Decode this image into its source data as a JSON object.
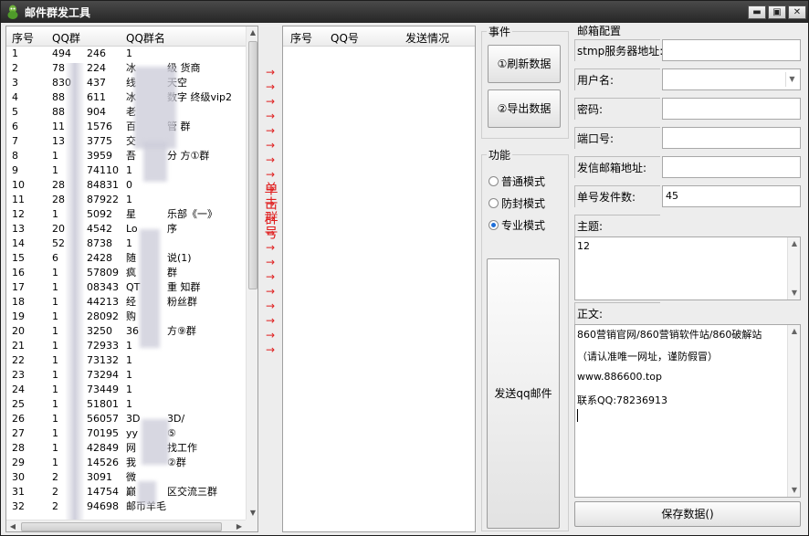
{
  "window": {
    "title": "邮件群发工具",
    "btn_min": "▬",
    "btn_max": "▣",
    "btn_close": "✕"
  },
  "left_list": {
    "headers": [
      "序号",
      "QQ群",
      "QQ群名"
    ],
    "rows": [
      [
        "1",
        "494",
        "1"
      ],
      [
        "2",
        "78",
        "冰"
      ],
      [
        "3",
        "830",
        "线"
      ],
      [
        "4",
        "88",
        "冰"
      ],
      [
        "5",
        "88",
        "老"
      ],
      [
        "6",
        "11",
        "百"
      ],
      [
        "7",
        "13",
        "交"
      ],
      [
        "8",
        "1",
        "吾"
      ],
      [
        "9",
        "1",
        "1"
      ],
      [
        "10",
        "28",
        "0"
      ],
      [
        "11",
        "28",
        "1"
      ],
      [
        "12",
        "1",
        "星"
      ],
      [
        "13",
        "20",
        "Lo"
      ],
      [
        "14",
        "52",
        "1"
      ],
      [
        "15",
        "6",
        "随"
      ],
      [
        "16",
        "1",
        "疯"
      ],
      [
        "17",
        "1",
        "QT"
      ],
      [
        "18",
        "1",
        "经"
      ],
      [
        "19",
        "1",
        "购"
      ],
      [
        "20",
        "1",
        "36"
      ],
      [
        "21",
        "1",
        "1"
      ],
      [
        "22",
        "1",
        "1"
      ],
      [
        "23",
        "1",
        "1"
      ],
      [
        "24",
        "1",
        "1"
      ],
      [
        "25",
        "1",
        "1"
      ],
      [
        "26",
        "1",
        "3D"
      ],
      [
        "27",
        "1",
        "yy"
      ],
      [
        "28",
        "1",
        "网"
      ],
      [
        "29",
        "1",
        "我"
      ],
      [
        "30",
        "2",
        "微"
      ],
      [
        "31",
        "2",
        "巅"
      ],
      [
        "32",
        "2",
        "邮币羊毛"
      ]
    ],
    "col2_tails": [
      "246",
      "224",
      "437",
      "611",
      "904",
      "1576",
      "3775",
      "3959",
      "74110",
      "84831",
      "87922",
      "5092",
      "4542",
      "8738",
      "2428",
      "57809",
      "08343",
      "44213",
      "28092",
      "3250",
      "72933",
      "73132",
      "73294",
      "73449",
      "51801",
      "56057",
      "70195",
      "42849",
      "14526",
      "3091",
      "14754",
      "94698"
    ],
    "col3_tails": [
      "",
      "级 货商",
      "天空",
      "数字 终级vip2",
      "",
      "管 群",
      "",
      "分 方①群",
      "",
      "",
      "",
      "乐部《一》",
      "序",
      "",
      "说(1)",
      "群",
      "重 知群",
      "  粉丝群",
      "",
      "方⑨群",
      "",
      "",
      "",
      "",
      "",
      "3D/",
      "⑤",
      "找工作",
      "②群",
      "",
      "区交流三群",
      ""
    ]
  },
  "right_list": {
    "headers": [
      "序号",
      "QQ号",
      "发送情况"
    ]
  },
  "arrows": {
    "glyph": "→",
    "side_text": "单击群号"
  },
  "events": {
    "label": "事件",
    "refresh_btn": "①刷新数据",
    "export_btn": "②导出数据"
  },
  "func": {
    "label": "功能",
    "options": [
      "普通模式",
      "防封模式",
      "专业模式"
    ],
    "selected": 2,
    "send_btn": "发送qq邮件"
  },
  "config": {
    "label": "邮箱配置",
    "fields": [
      {
        "label": "stmp服务器地址:",
        "value": ""
      },
      {
        "label": "用户名:",
        "value": ""
      },
      {
        "label": "密码:",
        "value": ""
      },
      {
        "label": "端口号:",
        "value": ""
      },
      {
        "label": "发信邮箱地址:",
        "value": ""
      },
      {
        "label": "单号发件数:",
        "value": "45"
      }
    ],
    "subject_label": "主题:",
    "subject_value": "12",
    "body_label": "正文:",
    "body_lines": [
      "860营销官网/860营销软件站/860破解站",
      "（请认准唯一网址，谨防假冒）",
      "  www.886600.top",
      " 联系QQ:78236913"
    ],
    "save_btn": "保存数据()"
  }
}
